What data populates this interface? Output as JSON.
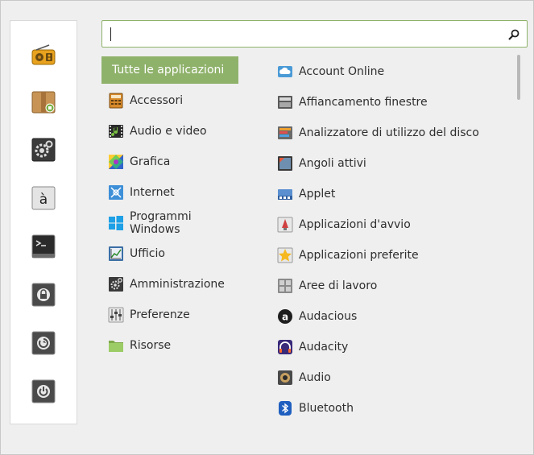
{
  "search": {
    "value": "",
    "placeholder": ""
  },
  "favorites": [
    {
      "icon": "radio-icon"
    },
    {
      "icon": "package-manager-icon"
    },
    {
      "icon": "system-settings-icon"
    },
    {
      "icon": "character-map-icon"
    },
    {
      "icon": "terminal-icon"
    },
    {
      "icon": "lock-screen-icon"
    },
    {
      "icon": "logout-icon"
    },
    {
      "icon": "shutdown-icon"
    }
  ],
  "categories": [
    {
      "label": "Tutte le applicazioni",
      "selected": true
    },
    {
      "label": "Accessori",
      "icon": "accessories-icon"
    },
    {
      "label": "Audio e video",
      "icon": "multimedia-icon"
    },
    {
      "label": "Grafica",
      "icon": "graphics-icon"
    },
    {
      "label": "Internet",
      "icon": "internet-icon"
    },
    {
      "label": "Programmi Windows",
      "icon": "windows-icon"
    },
    {
      "label": "Ufficio",
      "icon": "office-icon"
    },
    {
      "label": "Amministrazione",
      "icon": "administration-icon"
    },
    {
      "label": "Preferenze",
      "icon": "preferences-icon"
    },
    {
      "label": "Risorse",
      "icon": "folder-icon"
    }
  ],
  "apps": [
    {
      "label": "Account Online",
      "icon": "online-accounts-icon"
    },
    {
      "label": "Affiancamento finestre",
      "icon": "window-tiling-icon"
    },
    {
      "label": "Analizzatore di utilizzo del disco",
      "icon": "disk-usage-icon"
    },
    {
      "label": "Angoli attivi",
      "icon": "hot-corners-icon"
    },
    {
      "label": "Applet",
      "icon": "applets-icon"
    },
    {
      "label": "Applicazioni d'avvio",
      "icon": "startup-apps-icon"
    },
    {
      "label": "Applicazioni preferite",
      "icon": "preferred-apps-icon"
    },
    {
      "label": "Aree di lavoro",
      "icon": "workspaces-icon"
    },
    {
      "label": "Audacious",
      "icon": "audacious-icon"
    },
    {
      "label": "Audacity",
      "icon": "audacity-icon"
    },
    {
      "label": "Audio",
      "icon": "sound-icon"
    },
    {
      "label": "Bluetooth",
      "icon": "bluetooth-icon"
    }
  ],
  "colors": {
    "accent": "#8fb26b"
  }
}
